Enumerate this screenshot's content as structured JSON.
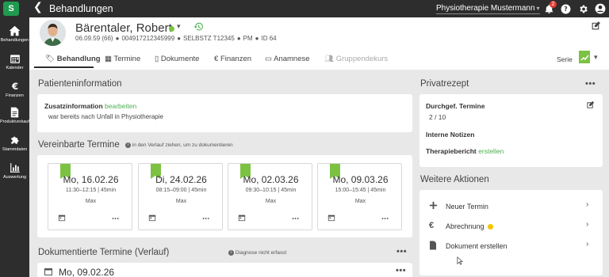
{
  "app": {
    "logo_text": "S",
    "back_glyph": "❮",
    "title": "Behandlungen",
    "practice": "Physiotherapie Mustermann",
    "notification_count": "2"
  },
  "sidebar": {
    "items": [
      {
        "icon": "home-icon",
        "label": "Behandlungen"
      },
      {
        "icon": "calendar-icon",
        "label": "Kalender"
      },
      {
        "icon": "euro-icon",
        "label": "Finanzen"
      },
      {
        "icon": "document-icon",
        "label": "Produktverkauf"
      },
      {
        "icon": "puzzle-icon",
        "label": "Stammdaten"
      },
      {
        "icon": "bar-chart-icon",
        "label": "Auswertung"
      }
    ]
  },
  "patient": {
    "name": "Bärentaler, Robert",
    "birth": "06.09.59 (66)",
    "phone": "004917212345999",
    "insurance": "SELBSTZ T12345",
    "type": "PM",
    "id": "ID 64",
    "status_color": "#7cc242"
  },
  "tabs": [
    {
      "label": "Behandlung",
      "icon": "bookmark-icon",
      "active": true
    },
    {
      "label": "Termine",
      "icon": "calendar-icon"
    },
    {
      "label": "Dokumente",
      "icon": "file-icon"
    },
    {
      "label": "Finanzen",
      "icon": "euro-icon"
    },
    {
      "label": "Anamnese",
      "icon": "card-icon"
    },
    {
      "label": "Gruppendekurs",
      "icon": "group-icon",
      "disabled": true
    }
  ],
  "serie": {
    "label": "Serie"
  },
  "patientinfo": {
    "title": "Patienteninformation",
    "label": "Zusatzinformation",
    "edit": "bearbeiten",
    "text": "war bereits nach Unfall in Physiotherapie"
  },
  "vereinbarte": {
    "title": "Vereinbarte Termine",
    "hint": "in den Verlauf ziehen, um zu dokumentieren",
    "appointments": [
      {
        "date": "Mo, 16.02.26",
        "time": "11:30–12:15 | 45min",
        "therapist": "Max"
      },
      {
        "date": "Di, 24.02.26",
        "time": "08:15–09:00 | 45min",
        "therapist": "Max"
      },
      {
        "date": "Mo, 02.03.26",
        "time": "09:30–10:15 | 45min",
        "therapist": "Max"
      },
      {
        "date": "Mo, 09.03.26",
        "time": "15:00–15:45 | 45min",
        "therapist": "Max"
      }
    ],
    "more": "..."
  },
  "dokumentierte": {
    "title": "Dokumentierte Termine (Verlauf)",
    "hint": "Diagnose nicht erfasst",
    "first_date": "Mo, 09.02.26"
  },
  "privatrezept": {
    "title": "Privatrezept",
    "done_label": "Durchgef. Termine",
    "done_value": "2 / 10",
    "notes_label": "Interne Notizen",
    "report_label": "Therapiebericht",
    "report_action": "erstellen"
  },
  "weitere": {
    "title": "Weitere Aktionen",
    "actions": [
      {
        "label": "Neuer Termin",
        "icon": "plus-icon"
      },
      {
        "label": "Abrechnung",
        "icon": "euro-icon",
        "badge_color": "#f5c400"
      },
      {
        "label": "Dokument erstellen",
        "icon": "file-icon"
      }
    ]
  }
}
